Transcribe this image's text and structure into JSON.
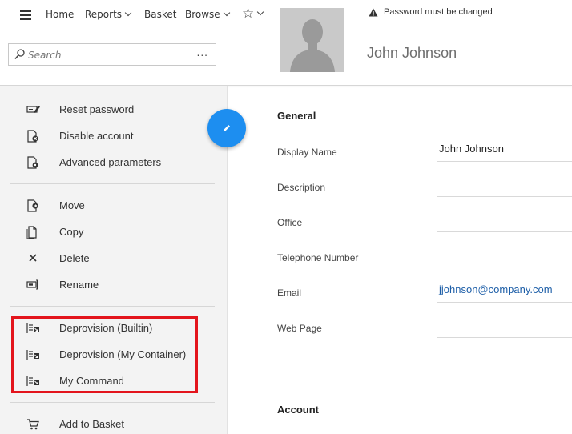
{
  "nav": {
    "home": "Home",
    "reports": "Reports",
    "basket": "Basket",
    "browse": "Browse"
  },
  "search": {
    "placeholder": "Search",
    "more": "..."
  },
  "header": {
    "user_name": "John Johnson",
    "warning": "Password must be changed"
  },
  "sidebar": {
    "group1": [
      {
        "label": "Reset password",
        "icon": "reset-password-icon"
      },
      {
        "label": "Disable account",
        "icon": "disable-account-icon"
      },
      {
        "label": "Advanced parameters",
        "icon": "advanced-parameters-icon"
      }
    ],
    "group2": [
      {
        "label": "Move",
        "icon": "move-icon"
      },
      {
        "label": "Copy",
        "icon": "copy-icon"
      },
      {
        "label": "Delete",
        "icon": "delete-icon"
      },
      {
        "label": "Rename",
        "icon": "rename-icon"
      }
    ],
    "group3": [
      {
        "label": "Deprovision (Builtin)",
        "icon": "deprovision-icon"
      },
      {
        "label": "Deprovision (My Container)",
        "icon": "deprovision-icon"
      },
      {
        "label": "My Command",
        "icon": "command-icon"
      }
    ],
    "group4": [
      {
        "label": "Add to Basket",
        "icon": "basket-icon"
      }
    ]
  },
  "general": {
    "title": "General",
    "fields": [
      {
        "label": "Display Name",
        "value": "John Johnson"
      },
      {
        "label": "Description",
        "value": ""
      },
      {
        "label": "Office",
        "value": ""
      },
      {
        "label": "Telephone Number",
        "value": ""
      },
      {
        "label": "Email",
        "value": "jjohnson@company.com"
      },
      {
        "label": "Web Page",
        "value": ""
      }
    ]
  },
  "account": {
    "title": "Account"
  },
  "colors": {
    "accent": "#1d8ef0",
    "highlight": "#e3141c",
    "link": "#1e5fa8"
  }
}
